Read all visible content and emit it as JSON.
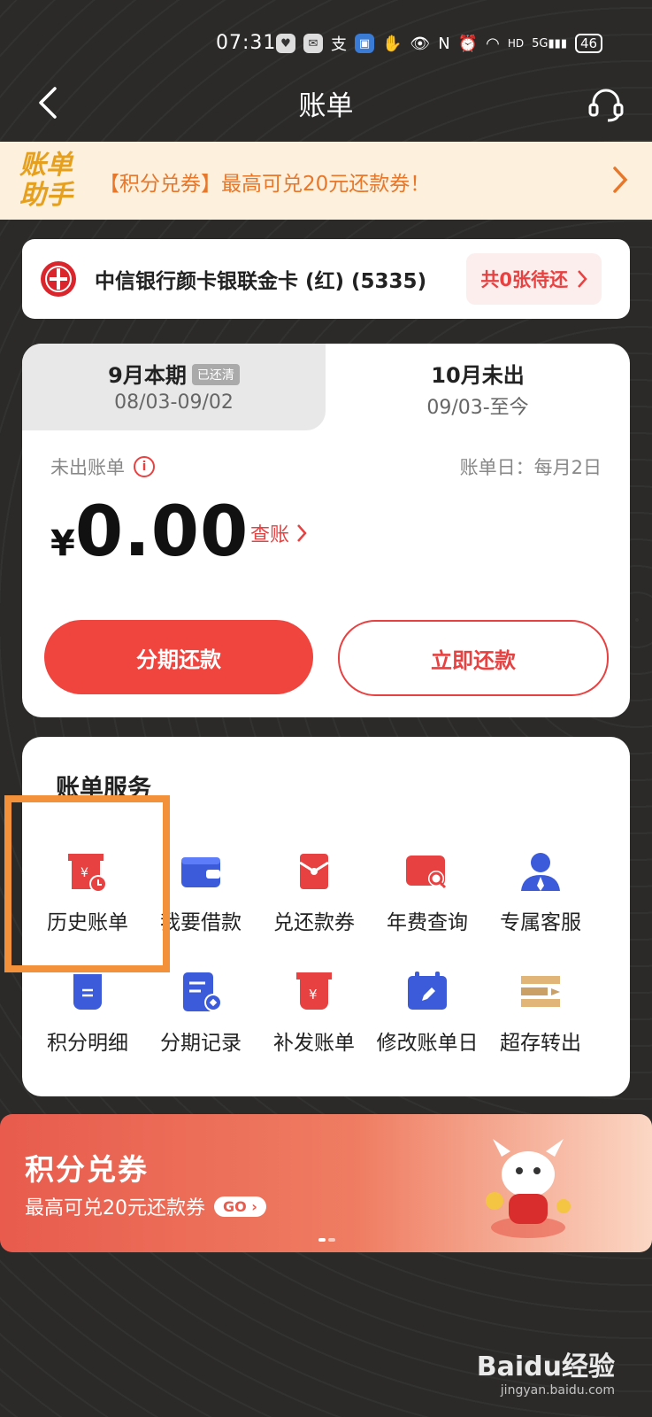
{
  "status_bar": {
    "time": "07:31",
    "battery": "46",
    "network": "5G"
  },
  "header": {
    "title": "账单"
  },
  "promo_strip": {
    "logo_text": "账单助手",
    "text": "【积分兑券】最高可兑20元还款券！"
  },
  "card": {
    "name": "中信银行颜卡银联金卡 (红) (5335)",
    "pending": "共0张待还"
  },
  "bill": {
    "current_tab": {
      "title": "9月本期",
      "badge": "已还清",
      "range": "08/03-09/02"
    },
    "next_tab": {
      "title": "10月未出",
      "range": "09/03-至今"
    },
    "unbilled_label": "未出账单",
    "billing_day": "账单日：每月2日",
    "currency": "¥",
    "amount": "0.00",
    "check_link": "查账",
    "installment_btn": "分期还款",
    "pay_btn": "立即还款"
  },
  "services": {
    "title": "账单服务",
    "items": [
      {
        "label": "历史账单",
        "icon": "history-bill-icon"
      },
      {
        "label": "我要借款",
        "icon": "wallet-icon"
      },
      {
        "label": "兑还款券",
        "icon": "red-envelope-icon"
      },
      {
        "label": "年费查询",
        "icon": "fee-search-icon"
      },
      {
        "label": "专属客服",
        "icon": "agent-icon"
      },
      {
        "label": "积分明细",
        "icon": "points-icon"
      },
      {
        "label": "分期记录",
        "icon": "installment-record-icon"
      },
      {
        "label": "补发账单",
        "icon": "reissue-bill-icon"
      },
      {
        "label": "修改账单日",
        "icon": "calendar-edit-icon"
      },
      {
        "label": "超存转出",
        "icon": "transfer-out-icon"
      }
    ]
  },
  "banner": {
    "title": "积分兑券",
    "subtitle": "最高可兑20元还款券",
    "go": "GO"
  },
  "watermark": {
    "brand": "Baidu经验",
    "url": "jingyan.baidu.com"
  },
  "colors": {
    "accent": "#e84141",
    "promo_orange": "#e6772b",
    "highlight": "#f2913a"
  }
}
